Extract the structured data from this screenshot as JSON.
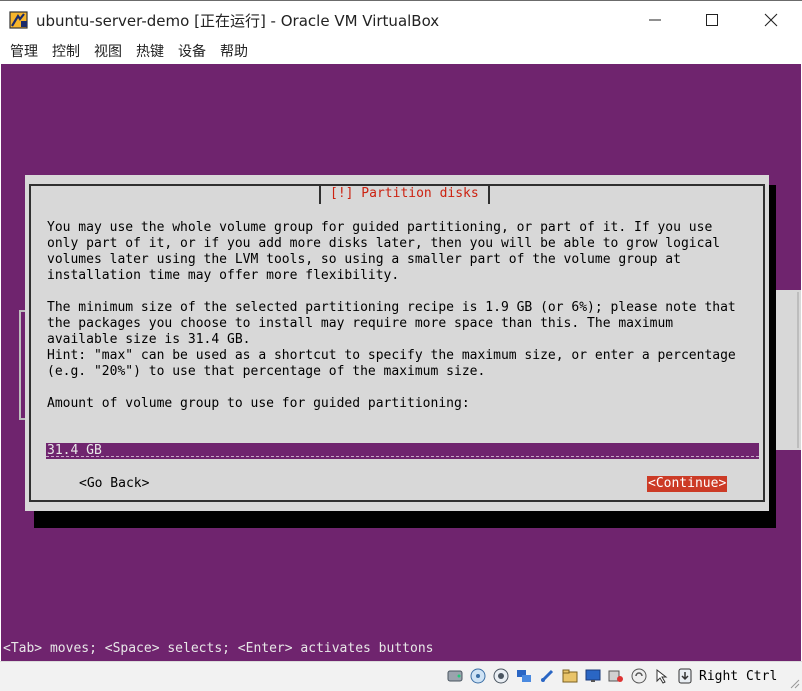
{
  "window": {
    "title": "ubuntu-server-demo [正在运行] - Oracle VM VirtualBox"
  },
  "menu": {
    "items": [
      "管理",
      "控制",
      "视图",
      "热键",
      "设备",
      "帮助"
    ]
  },
  "dialog": {
    "title": "[!] Partition disks",
    "paragraph1": "You may use the whole volume group for guided partitioning, or part of it. If you use\nonly part of it, or if you add more disks later, then you will be able to grow logical\nvolumes later using the LVM tools, so using a smaller part of the volume group at\ninstallation time may offer more flexibility.",
    "paragraph2": "The minimum size of the selected partitioning recipe is 1.9 GB (or 6%); please note that\nthe packages you choose to install may require more space than this. The maximum\navailable size is 31.4 GB.",
    "paragraph3": "Hint: \"max\" can be used as a shortcut to specify the maximum size, or enter a percentage\n(e.g. \"20%\") to use that percentage of the maximum size.",
    "prompt": "Amount of volume group to use for guided partitioning:",
    "input_value": "31.4 GB",
    "go_back_label": "<Go Back>",
    "continue_label": "<Continue>"
  },
  "help_line": "<Tab> moves; <Space> selects; <Enter> activates buttons",
  "statusbar": {
    "host_key": "Right Ctrl",
    "icons": [
      "hard-disk-icon",
      "optical-drive-icon",
      "audio-icon",
      "network-icon",
      "usb-icon",
      "shared-folder-icon",
      "display-icon",
      "video-capture-icon",
      "cpu-icon",
      "mouse-integration-icon",
      "keyboard-capture-icon"
    ]
  },
  "colors": {
    "vm_background": "#6f246e",
    "dialog_background": "#d8d8d8",
    "dialog_title": "#cc2211",
    "continue_button": "#cc3b26"
  }
}
